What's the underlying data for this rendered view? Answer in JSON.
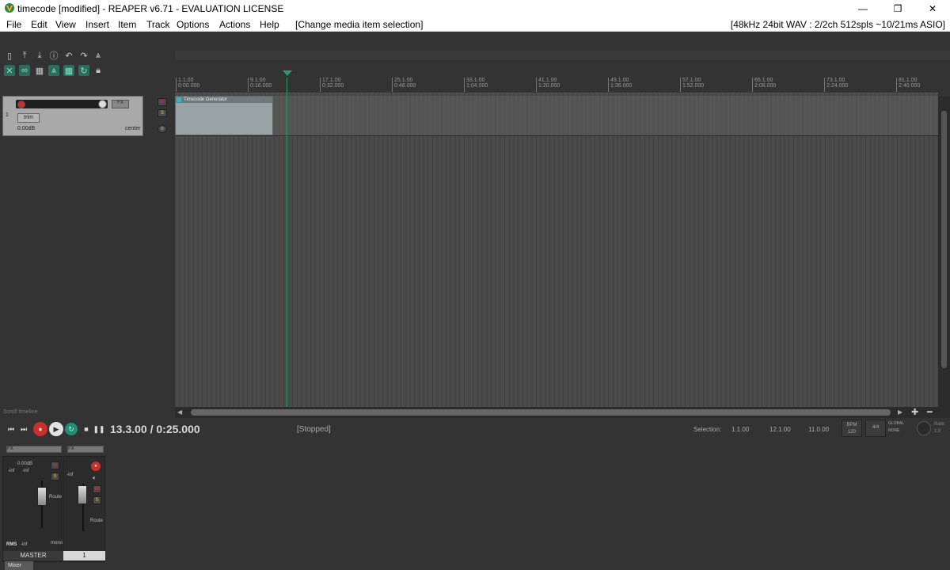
{
  "window": {
    "title": "timecode [modified] - REAPER v6.71 - EVALUATION LICENSE",
    "minimize_glyph": "—",
    "maximize_glyph": "❐",
    "close_glyph": "✕"
  },
  "menu": {
    "items": [
      "File",
      "Edit",
      "View",
      "Insert",
      "Item",
      "Track",
      "Options",
      "Actions",
      "Help"
    ],
    "status": "[Change media item selection]",
    "audio_info": "[48kHz 24bit WAV : 2/2ch 512spls ~10/21ms ASIO]"
  },
  "toolbar": {
    "icons": [
      "new-project-icon",
      "open-project-icon",
      "save-project-icon",
      "project-settings-icon",
      "undo-icon",
      "redo-icon",
      "metronome-icon",
      "ripple-edit-icon",
      "link-icon",
      "grid-icon",
      "snap-icon",
      "lock-grid-icon",
      "loop-icon",
      "lock-icon"
    ]
  },
  "ruler": {
    "marks": [
      {
        "bar": "1.1.00",
        "time": "0:00.000"
      },
      {
        "bar": "9.1.00",
        "time": "0:16.000"
      },
      {
        "bar": "17.1.00",
        "time": "0:32.000"
      },
      {
        "bar": "25.1.00",
        "time": "0:48.000"
      },
      {
        "bar": "33.1.00",
        "time": "1:04.000"
      },
      {
        "bar": "41.1.00",
        "time": "1:20.000"
      },
      {
        "bar": "49.1.00",
        "time": "1:36.000"
      },
      {
        "bar": "57.1.00",
        "time": "1:52.000"
      },
      {
        "bar": "65.1.00",
        "time": "2:08.000"
      },
      {
        "bar": "73.1.00",
        "time": "2:24.000"
      },
      {
        "bar": "81.1.00",
        "time": "2:40.000"
      }
    ]
  },
  "track": {
    "number": "1",
    "trim_label": "trim",
    "fx_label": "FX",
    "volume": "0.00dB",
    "pan": "center",
    "mute": "M",
    "solo": "S"
  },
  "media_item": {
    "name": "Timecode Generator"
  },
  "scroll": {
    "label": "Scroll timeline"
  },
  "transport": {
    "time": "13.3.00 / 0:25.000",
    "state": "[Stopped]",
    "selection_label": "Selection:",
    "sel_start": "1.1.00",
    "sel_end": "12.1.00",
    "sel_length": "11.0.00",
    "bpm_label": "BPM",
    "bpm": "120",
    "time_sig": "4/4",
    "global_label": "GLOBAL",
    "none_label": "NONE",
    "rate_label": "Rate:",
    "rate": "1.0"
  },
  "mixer": {
    "master_name": "MASTER",
    "master_db": "0.00dB",
    "master_rms": "RMS",
    "inf": "-inf",
    "fx_label": "FX",
    "track1_name": "1",
    "route_label": "Route",
    "mono_label": "mono",
    "tab_label": "Mixer"
  }
}
